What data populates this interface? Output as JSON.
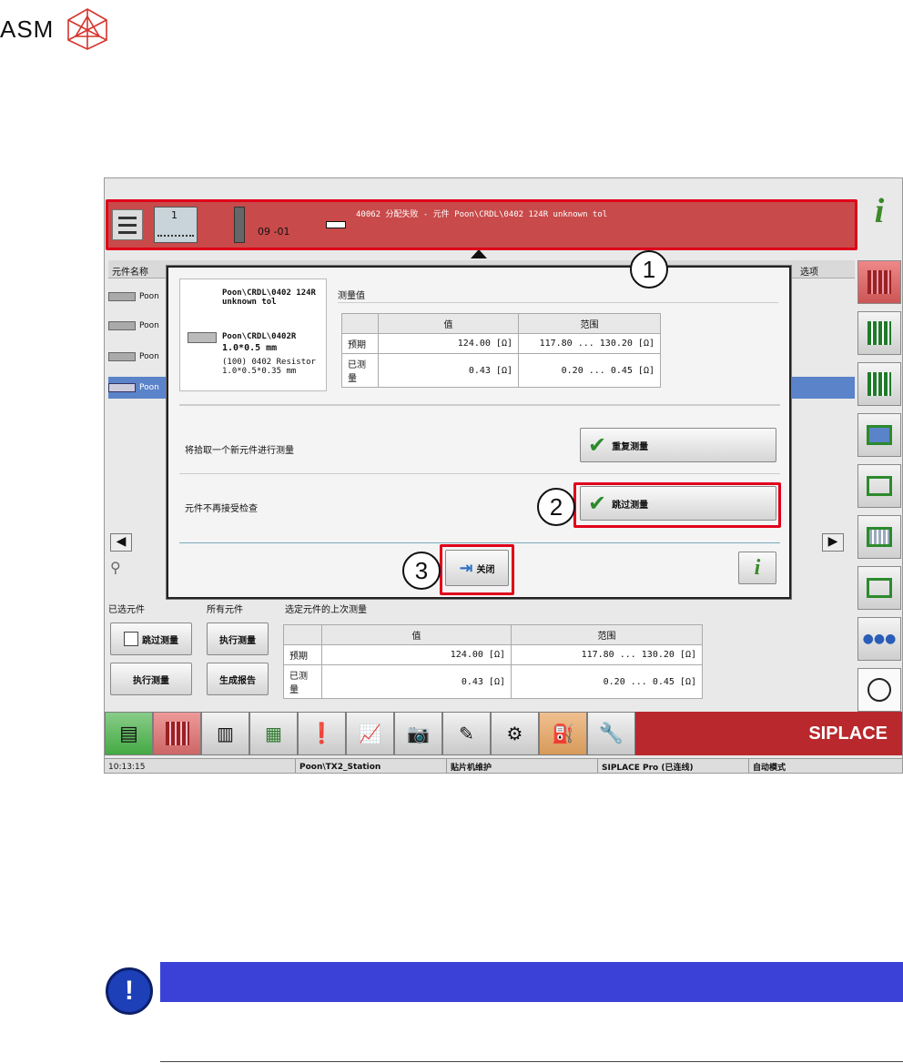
{
  "logo": {
    "text": "ASM"
  },
  "topbar": {
    "slot": "1",
    "track": "09 -01",
    "message": "40062 分配失败 - 元件 Poon\\CRDL\\0402 124R unknown tol"
  },
  "table": {
    "col_name": "元件名称",
    "col_options": "选项",
    "rows": [
      "Poon",
      "Poon",
      "Poon",
      "Poon"
    ]
  },
  "dialog": {
    "component": {
      "name": "Poon\\CRDL\\0402 124R unknown tol",
      "part": "Poon\\CRDL\\0402R",
      "size": "1.0*0.5 mm",
      "desc": "(100) 0402 Resistor 1.0*0.5*0.35 mm"
    },
    "measure_title": "测量值",
    "headers": [
      "值",
      "范围"
    ],
    "rows": [
      {
        "label": "预期",
        "value": "124.00 [Ω]",
        "range": "117.80 ... 130.20 [Ω]"
      },
      {
        "label": "已测量",
        "value": "0.43 [Ω]",
        "range": "0.20 ... 0.45 [Ω]"
      }
    ],
    "text_new": "将拾取一个新元件进行测量",
    "btn_repeat": "重复测量",
    "text_reject": "元件不再接受检查",
    "btn_skip": "跳过测量",
    "btn_close": "关闭"
  },
  "lower": {
    "tab_selected": "已选元件",
    "tab_all": "所有元件",
    "last_title": "选定元件的上次测量",
    "btn_skip": "跳过测量",
    "btn_exec1": "执行测量",
    "btn_exec2": "执行测量",
    "btn_report": "生成报告",
    "headers": [
      "值",
      "范围"
    ],
    "rows": [
      {
        "label": "预期",
        "value": "124.00 [Ω]",
        "range": "117.80 ... 130.20 [Ω]"
      },
      {
        "label": "已测量",
        "value": "0.43 [Ω]",
        "range": "0.20 ... 0.45 [Ω]"
      }
    ]
  },
  "brand": "SIPLACE",
  "status": {
    "time": "10:13:15",
    "station": "Poon\\TX2_Station",
    "maint": "贴片机维护",
    "pro": "SIPLACE Pro (已连线)",
    "mode": "自动模式"
  },
  "callouts": [
    "1",
    "2",
    "3"
  ],
  "colors": {
    "alert": "#c94a4a",
    "highlight": "#e0001a",
    "brand_bg": "#b8282c",
    "note_bar": "#3b41d6"
  }
}
